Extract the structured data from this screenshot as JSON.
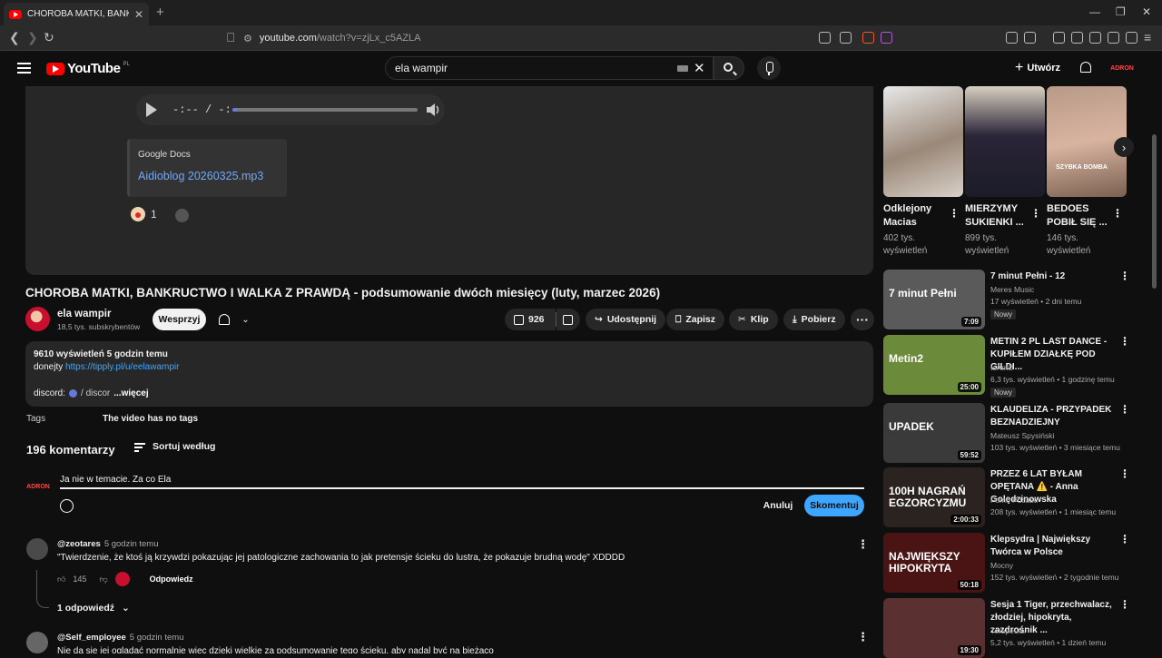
{
  "browser": {
    "tab_title": "CHOROBA MATKI, BANKRUCTWO",
    "url_host": "youtube.com",
    "url_path": "/watch?v=zjLx_c5AZLA"
  },
  "header": {
    "logo": "YouTube",
    "country": "PL",
    "search_value": "ela wampir",
    "create_label": "Utwórz",
    "account_label": "ADRON"
  },
  "embed": {
    "time": "-:-- / -:--",
    "audio_progress": 0.03,
    "provider": "Google Docs",
    "file_link": "Aidioblog 20260325.mp3",
    "reaction_count": "1"
  },
  "video": {
    "title": "CHOROBA MATKI, BANKRUCTWO I WALKA Z PRAWDĄ - podsumowanie dwóch miesięcy (luty, marzec 2026)",
    "channel_name": "ela wampir",
    "subscribers": "18,5 tys. subskrybentów",
    "support_label": "Wesprzyj",
    "likes": "926",
    "share_label": "Udostępnij",
    "save_label": "Zapisz",
    "clip_label": "Klip",
    "download_label": "Pobierz"
  },
  "description": {
    "stats": "9610 wyświetleń  5 godzin temu",
    "donate_prefix": "donejty ",
    "donate_link": "https://tipply.pl/u/eelawampir",
    "discord_prefix": "discord:",
    "discord_text": "/ discor",
    "more_label": "...więcej",
    "tags_label": "Tags",
    "tags_value": "The video has no tags"
  },
  "comments": {
    "count": "196 komentarzy",
    "sort_label": "Sortuj według",
    "my_avatar": "ADRON",
    "draft": "Ja nie w temacie. Za co Ela",
    "cancel_label": "Anuluj",
    "submit_label": "Skomentuj",
    "items": [
      {
        "author": "@zeotares",
        "time": "5 godzin temu",
        "text": "\"Twierdzenie, że ktoś ją krzywdzi pokazując jej patologiczne zachowania to jak pretensje ścieku do lustra, że pokazuje brudną wodę\" XDDDD",
        "likes": "145",
        "reply_label": "Odpowiedz",
        "replies_label": "1 odpowiedź"
      },
      {
        "author": "@Self_employee",
        "time": "5 godzin temu",
        "text": "Nie da się jej oglądać normalnie więc dzięki wielkie za podsumowanie tego ścieku, aby nadal być na bieżąco"
      }
    ]
  },
  "sidebar": {
    "shorts": [
      {
        "title": "Odklejony Macias",
        "views": "402 tys. wyświetleń"
      },
      {
        "title": "MIERZYMY SUKIENKI ...",
        "views": "899 tys. wyświetleń"
      },
      {
        "title": "BEDOES POBIŁ SIĘ ...",
        "views": "146 tys. wyświetleń",
        "overlay": "SZYBKA BOMBA"
      }
    ],
    "recommended": [
      {
        "title": "7 minut Pełni - 12",
        "channel": "Meres Music",
        "meta": "17 wyświetleń • 2 dni temu",
        "badge": "Nowy",
        "duration": "7:09",
        "overlay": "7 minut Pełni",
        "color": "#5a5a5a"
      },
      {
        "title": "METIN 2 PL LAST DANCE - KUPIŁEM DZIAŁKĘ POD GILDI...",
        "channel": "IsAmU",
        "meta": "6,3 tys. wyświetleń • 1 godzinę temu",
        "badge": "Nowy",
        "duration": "25:00",
        "overlay": "Metin2",
        "color": "#6b8a3a"
      },
      {
        "title": "KLAUDELIZA - PRZYPADEK BEZNADZIEJNY",
        "channel": "Mateusz Spysiński",
        "meta": "103 tys. wyświetleń • 3 miesiące temu",
        "duration": "59:52",
        "overlay": "UPADEK",
        "color": "#3a3a3a"
      },
      {
        "title": "PRZEZ 6 LAT BYŁAM OPĘTANA ⚠️ - Anna Golędzinowska",
        "channel": "Fomo Pdcast.",
        "meta": "208 tys. wyświetleń • 1 miesiąc temu",
        "duration": "2:00:33",
        "overlay": "100H NAGRAŃ EGZORCYZMU",
        "color": "#2a2320"
      },
      {
        "title": "Klepsydra | Największy Twórca w Polsce",
        "channel": "Mocny",
        "meta": "152 tys. wyświetleń • 2 tygodnie temu",
        "duration": "50:18",
        "overlay": "NAJWIĘKSZY HIPOKRYTA",
        "color": "#4a1414"
      },
      {
        "title": "Sesja 1 Tiger, przechwalacz, złodziej, hipokryta, zazdrośnik ...",
        "channel": "Terapeuta",
        "meta": "5,2 tys. wyświetleń • 1 dzień temu",
        "duration": "19:30",
        "overlay": "",
        "color": "#5a3030"
      }
    ]
  }
}
